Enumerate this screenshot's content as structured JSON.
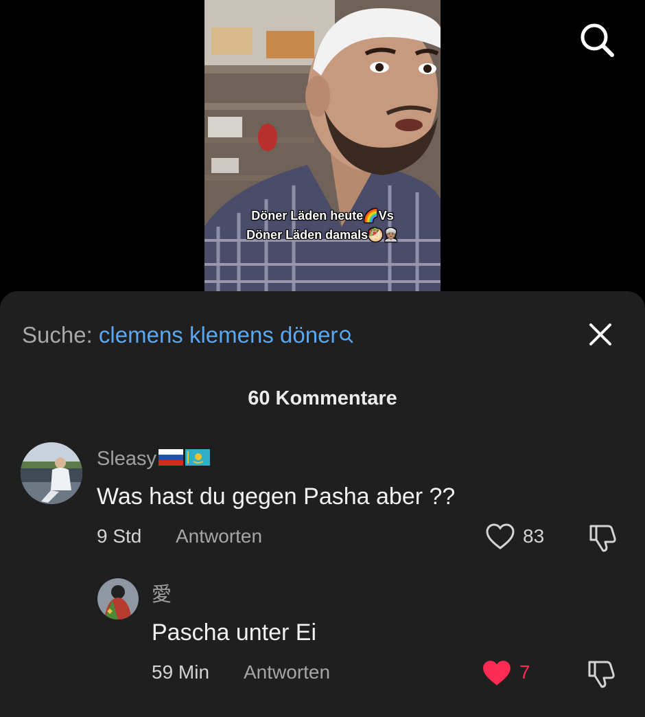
{
  "video": {
    "caption_line1": "Döner Läden heute🌈Vs",
    "caption_line2": "Döner Läden damals🥙👳🏽"
  },
  "search": {
    "prefix": "Suche: ",
    "query": "clemens klemens döner",
    "icons": {
      "top": "search-icon",
      "query": "search-icon",
      "close": "close-icon"
    }
  },
  "comments_header": {
    "count_label": "60 Kommentare"
  },
  "comments": [
    {
      "username": "Sleasy",
      "flags": [
        "russia-flag",
        "kazakhstan-flag"
      ],
      "text": "Was hast du gegen Pasha aber ??",
      "time": "9 Std",
      "reply_label": "Antworten",
      "likes": "83",
      "liked": false,
      "dislike_icon": "thumbs-down-icon"
    },
    {
      "username": "愛",
      "text": "Pascha unter Ei",
      "time": "59 Min",
      "reply_label": "Antworten",
      "likes": "7",
      "liked": true,
      "dislike_icon": "thumbs-down-icon"
    }
  ],
  "colors": {
    "sheet_bg": "#1f1f1f",
    "query_blue": "#5aa8f0",
    "like_red": "#fe2c55",
    "muted_text": "#a6a6a6"
  }
}
